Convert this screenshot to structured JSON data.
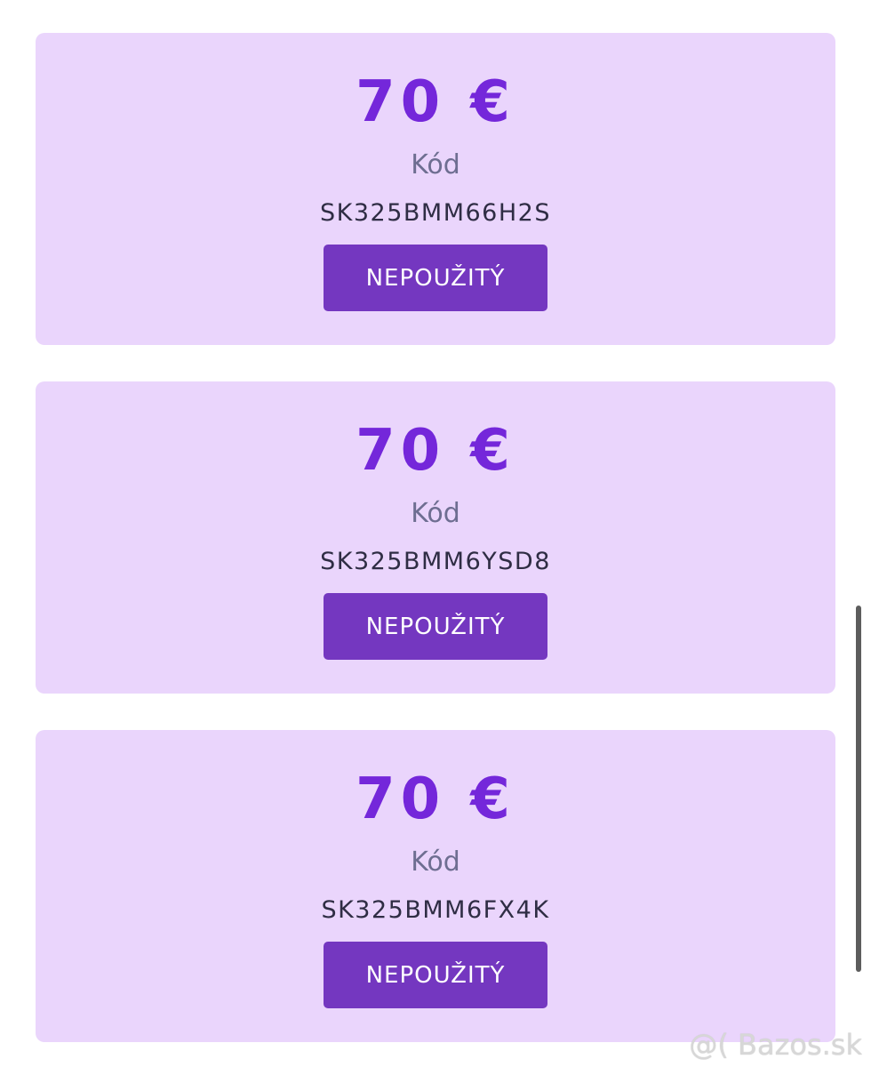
{
  "vouchers": [
    {
      "amount": "70 €",
      "code_label": "Kód",
      "code": "SK325BMM66H2S",
      "status": "NEPOUŽITÝ"
    },
    {
      "amount": "70 €",
      "code_label": "Kód",
      "code": "SK325BMM6YSD8",
      "status": "NEPOUŽITÝ"
    },
    {
      "amount": "70 €",
      "code_label": "Kód",
      "code": "SK325BMM6FX4K",
      "status": "NEPOUŽITÝ"
    }
  ],
  "watermark": "@( Bazos.sk",
  "colors": {
    "card_background": "#ead5fc",
    "amount": "#7427da",
    "button": "#7437c0",
    "label": "#6e6e91",
    "code": "#2f2d44"
  }
}
